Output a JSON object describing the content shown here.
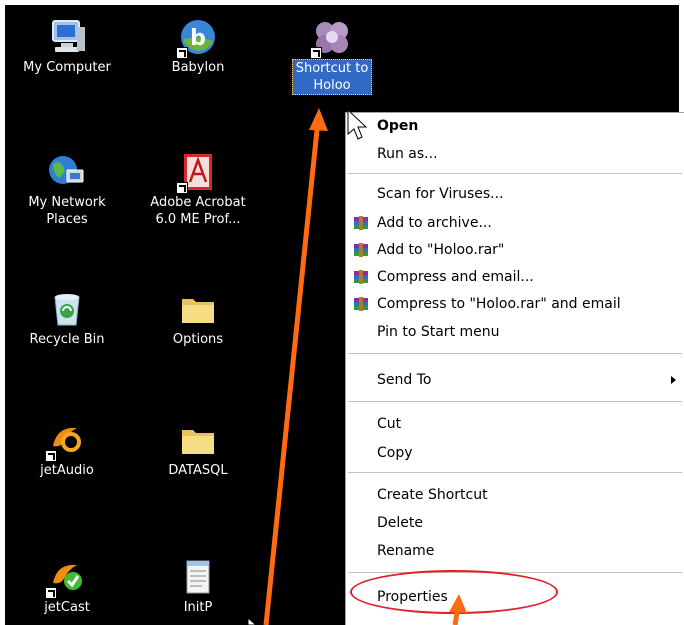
{
  "desktop": {
    "icons": [
      {
        "label": "My Computer",
        "icon": "my-computer-icon"
      },
      {
        "label": "Babylon",
        "icon": "babylon-icon"
      },
      {
        "label": "Shortcut to\nHoloo",
        "icon": "holoo-flower-icon"
      },
      {
        "label": "My Network\nPlaces",
        "icon": "network-places-icon"
      },
      {
        "label": "Adobe Acrobat\n6.0 ME Prof...",
        "icon": "adobe-acrobat-icon"
      },
      {
        "label": "Recycle Bin",
        "icon": "recycle-bin-icon"
      },
      {
        "label": "Options",
        "icon": "folder-icon"
      },
      {
        "label": "jetAudio",
        "icon": "jetaudio-icon"
      },
      {
        "label": "DATASQL",
        "icon": "folder-icon"
      },
      {
        "label": "jetCast",
        "icon": "jetcast-icon"
      },
      {
        "label": "InitP",
        "icon": "notepad-icon"
      }
    ]
  },
  "context_menu": {
    "items": [
      {
        "label": "Open"
      },
      {
        "label": "Run as..."
      },
      {
        "label": "Scan for Viruses..."
      },
      {
        "label": "Add to archive..."
      },
      {
        "label": "Add to \"Holoo.rar\""
      },
      {
        "label": "Compress and email..."
      },
      {
        "label": "Compress to \"Holoo.rar\" and email"
      },
      {
        "label": "Pin to Start menu"
      },
      {
        "label": "Send To"
      },
      {
        "label": "Cut"
      },
      {
        "label": "Copy"
      },
      {
        "label": "Create Shortcut"
      },
      {
        "label": "Delete"
      },
      {
        "label": "Rename"
      },
      {
        "label": "Properties"
      }
    ]
  },
  "colors": {
    "desktop_background": "#000000",
    "selection_blue": "#316ac5",
    "annotation_arrow": "#ff6a13",
    "annotation_ellipse": "#e0202a"
  }
}
